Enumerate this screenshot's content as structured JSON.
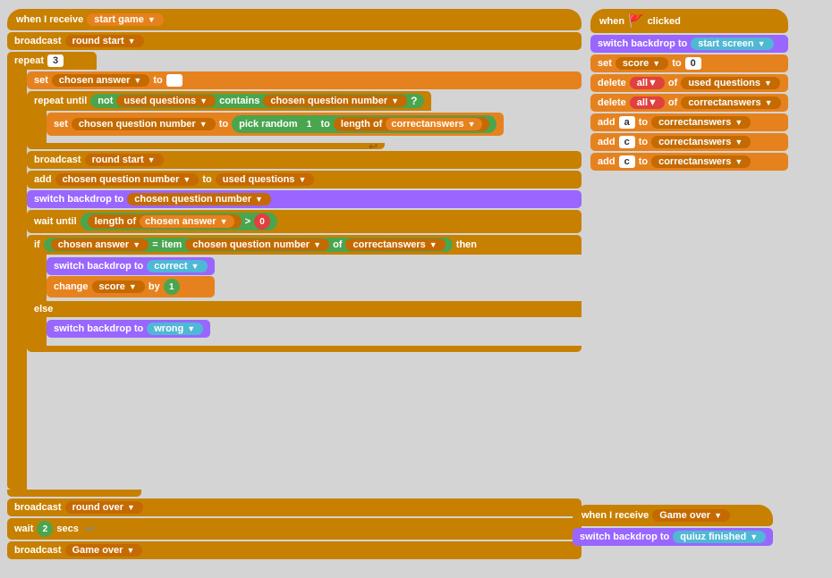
{
  "left_stack": {
    "block1_hat": "when I receive",
    "block1_msg": "start game",
    "block2": "broadcast",
    "block2_msg": "round start",
    "block3": "repeat",
    "block3_num": "3",
    "block4": "set",
    "block4_var": "chosen answer",
    "block4_to": "to",
    "block5": "repeat until",
    "block5_not": "not",
    "block5_list": "used questions",
    "block5_contains": "contains",
    "block5_var": "chosen question number",
    "block6": "set",
    "block6_var": "chosen question number",
    "block6_to": "to",
    "block6_pick": "pick random",
    "block6_one": "1",
    "block6_to2": "to",
    "block6_length": "length of",
    "block6_list": "correctanswers",
    "block7": "broadcast",
    "block7_msg": "round start",
    "block8": "add",
    "block8_var": "chosen question number",
    "block8_to": "to",
    "block8_list": "used questions",
    "block9": "switch backdrop to",
    "block9_val": "chosen question number",
    "block10": "wait until",
    "block10_length": "length of",
    "block10_var": "chosen answer",
    "block10_gt": ">",
    "block10_zero": "0",
    "block11_if": "if",
    "block11_then": "then",
    "block11_var": "chosen answer",
    "block11_eq": "=",
    "block11_item": "item",
    "block11_qnum": "chosen question number",
    "block11_of": "of",
    "block11_list": "correctanswers",
    "block12": "switch backdrop to",
    "block12_val": "correct",
    "block13": "change",
    "block13_var": "score",
    "block13_by": "by",
    "block13_num": "1",
    "block14_else": "else",
    "block15": "switch backdrop to",
    "block15_val": "wrong",
    "block16": "broadcast",
    "block16_msg": "round over",
    "block17": "wait",
    "block17_num": "2",
    "block17_secs": "secs",
    "block18": "broadcast",
    "block18_msg": "Game over"
  },
  "right_stack_top": {
    "hat": "when",
    "flag": "🚩",
    "clicked": "clicked",
    "b1": "switch backdrop to",
    "b1_val": "start screen",
    "b2_set": "set",
    "b2_var": "score",
    "b2_to": "to",
    "b2_num": "0",
    "b3": "delete",
    "b3_all": "all▼",
    "b3_of": "of",
    "b3_list": "used questions",
    "b4": "delete",
    "b4_all": "all▼",
    "b4_of": "of",
    "b4_list": "correctanswers",
    "b5": "add",
    "b5_val": "a",
    "b5_to": "to",
    "b5_list": "correctanswers",
    "b6": "add",
    "b6_val": "c",
    "b6_to": "to",
    "b6_list": "correctanswers",
    "b7": "add",
    "b7_val": "c",
    "b7_to": "to",
    "b7_list": "correctanswers"
  },
  "right_stack_bottom": {
    "hat": "when I receive",
    "msg": "Game over",
    "b1": "switch backdrop to",
    "b1_val": "quiuz finished"
  }
}
